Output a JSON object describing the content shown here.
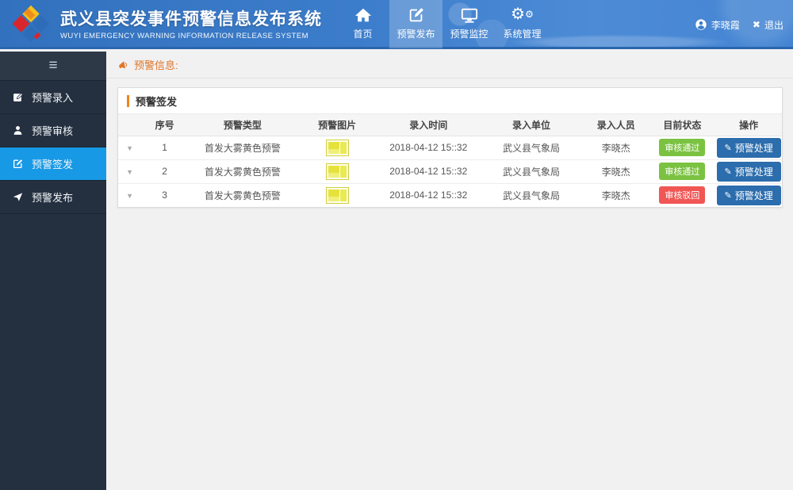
{
  "header": {
    "title": "武义县突发事件预警信息发布系统",
    "subtitle": "WUYI EMERGENCY WARNING  INFORMATION RELEASE SYSTEM",
    "nav": [
      {
        "label": "首页",
        "icon": "home-icon",
        "active": false
      },
      {
        "label": "预警发布",
        "icon": "edit-icon",
        "active": true
      },
      {
        "label": "预警监控",
        "icon": "monitor-icon",
        "active": false
      },
      {
        "label": "系统管理",
        "icon": "gears-icon",
        "active": false
      }
    ],
    "user": {
      "name": "李晓霞",
      "icon": "user-circle-icon"
    },
    "logout_label": "退出",
    "logout_icon": "close-icon"
  },
  "sidebar": {
    "toggle_icon": "menu-icon",
    "items": [
      {
        "label": "预警录入",
        "icon": "pencil-square-icon",
        "active": false
      },
      {
        "label": "预警审核",
        "icon": "person-icon",
        "active": false
      },
      {
        "label": "预警签发",
        "icon": "pencil-square-icon",
        "active": true
      },
      {
        "label": "预警发布",
        "icon": "paper-plane-icon",
        "active": false
      }
    ]
  },
  "breadcrumb": {
    "label": "预警信息:",
    "icon": "megaphone-icon"
  },
  "panel": {
    "title": "预警签发",
    "table": {
      "headers": [
        "序号",
        "预警类型",
        "预警图片",
        "录入时间",
        "录入单位",
        "录入人员",
        "目前状态",
        "操作"
      ],
      "rows": [
        {
          "seq": "1",
          "type": "首发大雾黄色预警",
          "image": "yellow-warning-thumbnail",
          "time": "2018-04-12 15::32",
          "unit": "武义县气象局",
          "person": "李晓杰",
          "status": "审核通过",
          "status_type": "success",
          "action": "预警处理"
        },
        {
          "seq": "2",
          "type": "首发大雾黄色预警",
          "image": "yellow-warning-thumbnail",
          "time": "2018-04-12 15::32",
          "unit": "武义县气象局",
          "person": "李晓杰",
          "status": "审核通过",
          "status_type": "success",
          "action": "预警处理"
        },
        {
          "seq": "3",
          "type": "首发大雾黄色预警",
          "image": "yellow-warning-thumbnail",
          "time": "2018-04-12 15::32",
          "unit": "武义县气象局",
          "person": "李晓杰",
          "status": "审核驳回",
          "status_type": "danger",
          "action": "预警处理"
        }
      ]
    }
  },
  "colors": {
    "header_blue": "#3c7dcb",
    "sidebar_dark": "#243040",
    "sidebar_active_blue": "#1899e6",
    "accent_orange": "#f08519",
    "breadcrumb_orange": "#e0762a",
    "badge_success_green": "#7cc242",
    "badge_danger_red": "#f05654",
    "action_button_blue": "#2c6dad"
  }
}
